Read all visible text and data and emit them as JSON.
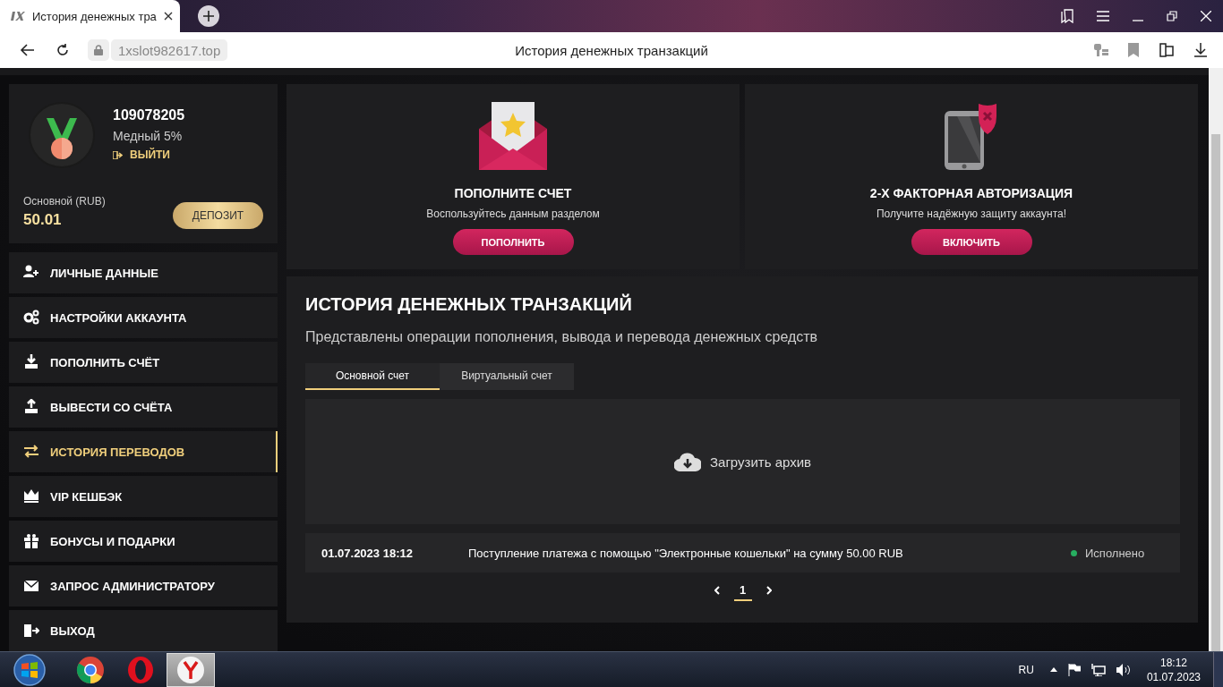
{
  "browser": {
    "tab_title": "История денежных тра",
    "address": "1xslot982617.top",
    "page_title": "История денежных транзакций"
  },
  "profile": {
    "account_id": "109078205",
    "level": "Медный 5%",
    "logout": "ВЫЙТИ",
    "balance_label": "Основной (RUB)",
    "balance": "50.01",
    "deposit_button": "ДЕПОЗИТ"
  },
  "sidebar": {
    "items": [
      {
        "label": "ЛИЧНЫЕ ДАННЫЕ",
        "selected": false
      },
      {
        "label": "НАСТРОЙКИ АККАУНТА",
        "selected": false
      },
      {
        "label": "ПОПОЛНИТЬ СЧЁТ",
        "selected": false
      },
      {
        "label": "ВЫВЕСТИ СО СЧЁТА",
        "selected": false
      },
      {
        "label": "ИСТОРИЯ ПЕРЕВОДОВ",
        "selected": true
      },
      {
        "label": "VIP КЕШБЭК",
        "selected": false
      },
      {
        "label": "БОНУСЫ И ПОДАРКИ",
        "selected": false
      },
      {
        "label": "ЗАПРОС АДМИНИСТРАТОРУ",
        "selected": false
      },
      {
        "label": "ВЫХОД",
        "selected": false
      }
    ]
  },
  "promos": [
    {
      "title": "ПОПОЛНИТЕ СЧЕТ",
      "text": "Воспользуйтесь данным разделом",
      "button": "ПОПОЛНИТЬ"
    },
    {
      "title": "2-Х ФАКТОРНАЯ АВТОРИЗАЦИЯ",
      "text": "Получите надёжную защиту аккаунта!",
      "button": "ВКЛЮЧИТЬ"
    }
  ],
  "history": {
    "title": "ИСТОРИЯ ДЕНЕЖНЫХ ТРАНЗАКЦИЙ",
    "subtitle": "Представлены операции пополнения, вывода и перевода денежных средств",
    "tabs": [
      {
        "label": "Основной счет",
        "selected": true
      },
      {
        "label": "Виртуальный счет",
        "selected": false
      }
    ],
    "archive_button": "Загрузить архив",
    "rows": [
      {
        "date": "01.07.2023 18:12",
        "description": "Поступление платежа с помощью \"Электронные кошельки\" на сумму 50.00 RUB",
        "status": "Исполнено",
        "color": "#27ae60"
      }
    ],
    "pagination": [
      {
        "label": "1",
        "selected": true
      }
    ]
  },
  "taskbar": {
    "apps": [
      {
        "selected": false
      },
      {
        "selected": false
      },
      {
        "selected": true
      }
    ],
    "language": "RU",
    "time": "18:12",
    "date": "01.07.2023"
  }
}
